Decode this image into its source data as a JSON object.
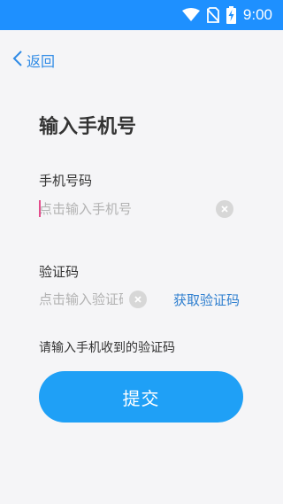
{
  "status_bar": {
    "time": "9:00",
    "icons": [
      "wifi-icon",
      "no-sim-icon",
      "battery-charging-icon"
    ],
    "background": "#1e90ff"
  },
  "nav": {
    "back_label": "返回",
    "back_icon": "chevron-left-icon"
  },
  "page": {
    "title": "输入手机号"
  },
  "form": {
    "phone_label": "手机号码",
    "phone_placeholder": "点击输入手机号",
    "phone_value": "",
    "code_label": "验证码",
    "code_placeholder": "点击输入验证码",
    "code_value": "",
    "clear_icon": "clear-icon",
    "get_code_label": "获取验证码",
    "hint": "请输入手机收到的验证码",
    "submit_label": "提交"
  },
  "colors": {
    "accent": "#1fa0f6",
    "link": "#2f7fcf",
    "background": "#f5f5f7"
  }
}
